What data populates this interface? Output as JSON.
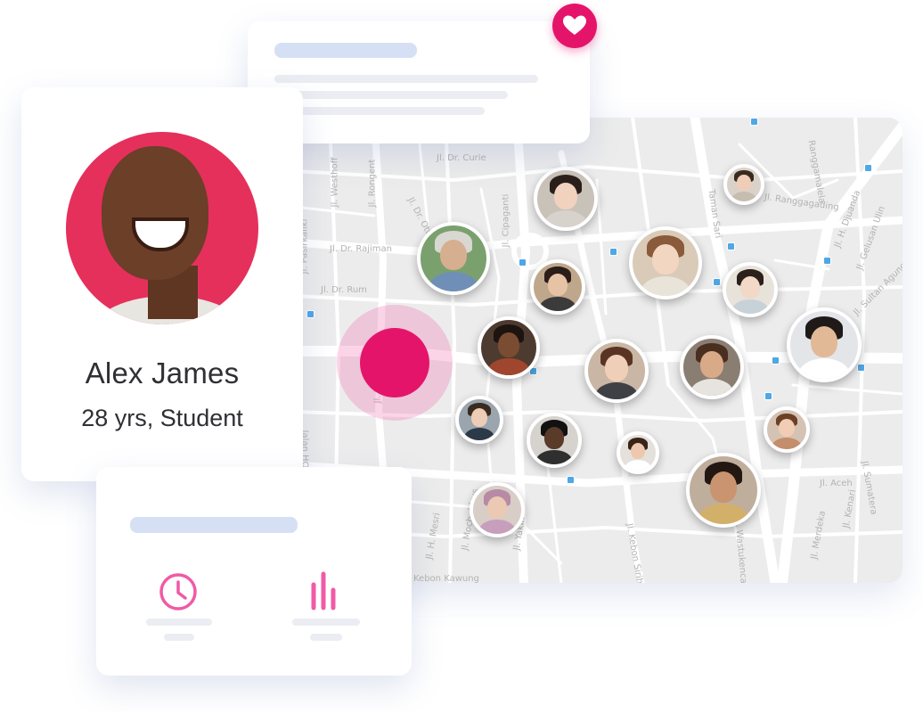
{
  "profile": {
    "name": "Alex James",
    "details": "28 yrs, Student"
  },
  "colors": {
    "accent": "#e5146b",
    "icon_pink": "#f05aa6",
    "placeholder_bar": "#d6e0f5",
    "placeholder_line": "#ebedf2",
    "map_bg": "#ececec",
    "road": "#ffffff",
    "map_marker": "#4fa7e6"
  },
  "notification_card": {
    "badge_icon": "heart-icon"
  },
  "stats_card": {
    "icons": [
      "clock-icon",
      "bar-chart-icon"
    ]
  },
  "map": {
    "streets": [
      "Jl. Westhoff",
      "Jl. Rongent",
      "Jl. Dr. Otten",
      "Jl. Dr. Curie",
      "Jl. Pasirkaliki",
      "Jl. Dr. Rajiman",
      "Jl. Dr. Rum",
      "Jl. Cipaganti",
      "Jl. Ranggagading",
      "Jl. H. Djuanda",
      "Jl. Gelusan Ulin",
      "Jl. Sultan Agung",
      "Jl. Aceh",
      "Jl. Merdeka",
      "Jl. Sumatera",
      "Jl. Kebon Sirih",
      "Jl. Wastukencana",
      "Jl. Moch. Toha",
      "Jalan HOS. Tjokro",
      "Jl. Yakin",
      "Jl. Moch. Idrus",
      "Jl. H. Mesri",
      "Kebon Kawung",
      "Jl. Kenari",
      "Ranggamalela",
      "Taman Sari"
    ]
  }
}
